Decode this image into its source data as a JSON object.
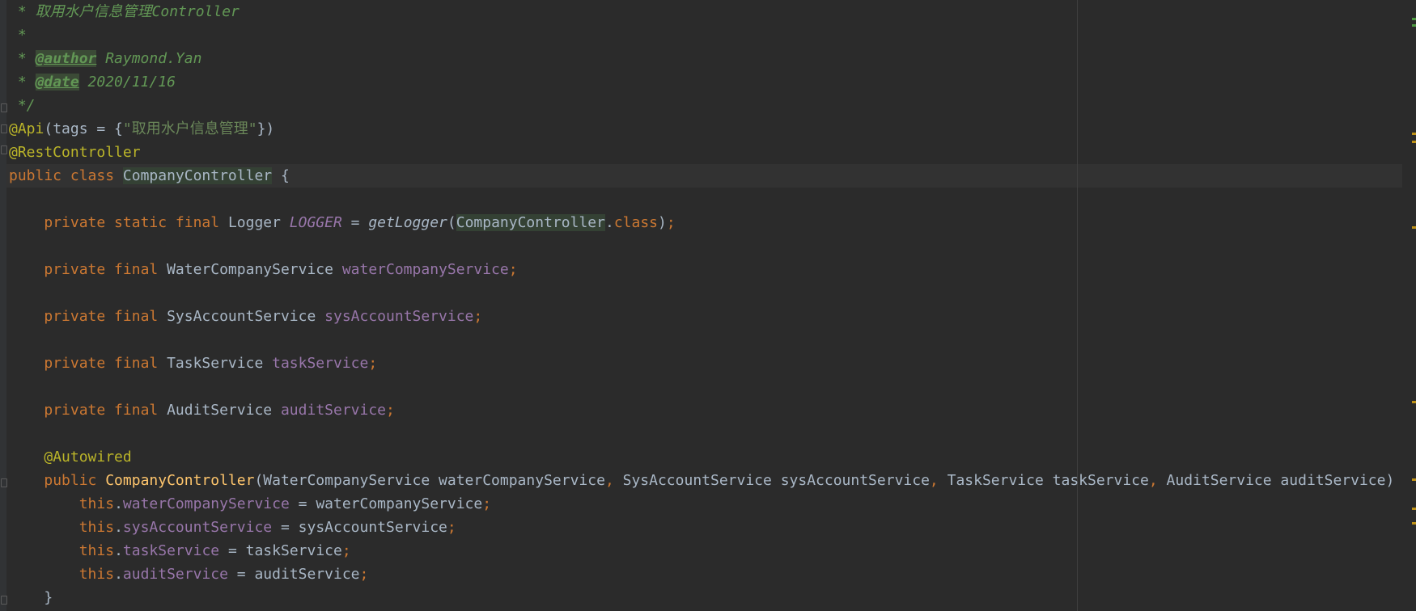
{
  "editor": {
    "lines": [
      [
        {
          "t": " * ",
          "c": "cm"
        },
        {
          "t": "取用水户信息管理Controller",
          "c": "cm"
        }
      ],
      [
        {
          "t": " *",
          "c": "cm"
        }
      ],
      [
        {
          "t": " * ",
          "c": "cm"
        },
        {
          "t": "@author",
          "c": "tag"
        },
        {
          "t": " Raymond.Yan",
          "c": "cm"
        }
      ],
      [
        {
          "t": " * ",
          "c": "cm"
        },
        {
          "t": "@date",
          "c": "tag"
        },
        {
          "t": " 2020/11/16",
          "c": "cm"
        }
      ],
      [
        {
          "t": " */",
          "c": "cm"
        }
      ],
      [
        {
          "t": "@Api",
          "c": "ann"
        },
        {
          "t": "(tags = {",
          "c": "p"
        },
        {
          "t": "\"取用水户信息管理\"",
          "c": "str"
        },
        {
          "t": "})",
          "c": "p"
        }
      ],
      [
        {
          "t": "@RestController",
          "c": "ann"
        }
      ],
      [
        {
          "t": "public class ",
          "c": "kw"
        },
        {
          "t": "CompanyController",
          "c": "hl"
        },
        {
          "t": " {",
          "c": "p"
        }
      ],
      [],
      [
        {
          "t": "    ",
          "c": "p"
        },
        {
          "t": "private static final ",
          "c": "kw"
        },
        {
          "t": "Logger ",
          "c": "p"
        },
        {
          "t": "LOGGER",
          "c": "sfld"
        },
        {
          "t": " = ",
          "c": "p"
        },
        {
          "t": "getLogger",
          "c": "smeth"
        },
        {
          "t": "(",
          "c": "p"
        },
        {
          "t": "CompanyController",
          "c": "hl"
        },
        {
          "t": ".",
          "c": "p"
        },
        {
          "t": "class",
          "c": "kw"
        },
        {
          "t": ")",
          "c": "p"
        },
        {
          "t": ";",
          "c": "kw"
        }
      ],
      [],
      [
        {
          "t": "    ",
          "c": "p"
        },
        {
          "t": "private final ",
          "c": "kw"
        },
        {
          "t": "WaterCompanyService ",
          "c": "p"
        },
        {
          "t": "waterCompanyService",
          "c": "fld"
        },
        {
          "t": ";",
          "c": "kw"
        }
      ],
      [],
      [
        {
          "t": "    ",
          "c": "p"
        },
        {
          "t": "private final ",
          "c": "kw"
        },
        {
          "t": "SysAccountService ",
          "c": "p"
        },
        {
          "t": "sysAccountService",
          "c": "fld"
        },
        {
          "t": ";",
          "c": "kw"
        }
      ],
      [],
      [
        {
          "t": "    ",
          "c": "p"
        },
        {
          "t": "private final ",
          "c": "kw"
        },
        {
          "t": "TaskService ",
          "c": "p"
        },
        {
          "t": "taskService",
          "c": "fld"
        },
        {
          "t": ";",
          "c": "kw"
        }
      ],
      [],
      [
        {
          "t": "    ",
          "c": "p"
        },
        {
          "t": "private final ",
          "c": "kw"
        },
        {
          "t": "AuditService ",
          "c": "p"
        },
        {
          "t": "auditService",
          "c": "fld"
        },
        {
          "t": ";",
          "c": "kw"
        }
      ],
      [],
      [
        {
          "t": "    ",
          "c": "p"
        },
        {
          "t": "@Autowired",
          "c": "ann"
        }
      ],
      [
        {
          "t": "    ",
          "c": "p"
        },
        {
          "t": "public ",
          "c": "kw"
        },
        {
          "t": "CompanyController",
          "c": "mdecl"
        },
        {
          "t": "(WaterCompanyService waterCompanyService",
          "c": "p"
        },
        {
          "t": ", ",
          "c": "kw"
        },
        {
          "t": "SysAccountService sysAccountService",
          "c": "p"
        },
        {
          "t": ", ",
          "c": "kw"
        },
        {
          "t": "TaskService taskService",
          "c": "p"
        },
        {
          "t": ", ",
          "c": "kw"
        },
        {
          "t": "AuditService auditService)",
          "c": "p"
        }
      ],
      [
        {
          "t": "        ",
          "c": "p"
        },
        {
          "t": "this",
          "c": "kw"
        },
        {
          "t": ".",
          "c": "p"
        },
        {
          "t": "waterCompanyService",
          "c": "fld"
        },
        {
          "t": " = waterCompanyService",
          "c": "p"
        },
        {
          "t": ";",
          "c": "kw"
        }
      ],
      [
        {
          "t": "        ",
          "c": "p"
        },
        {
          "t": "this",
          "c": "kw"
        },
        {
          "t": ".",
          "c": "p"
        },
        {
          "t": "sysAccountService",
          "c": "fld"
        },
        {
          "t": " = sysAccountService",
          "c": "p"
        },
        {
          "t": ";",
          "c": "kw"
        }
      ],
      [
        {
          "t": "        ",
          "c": "p"
        },
        {
          "t": "this",
          "c": "kw"
        },
        {
          "t": ".",
          "c": "p"
        },
        {
          "t": "taskService",
          "c": "fld"
        },
        {
          "t": " = taskService",
          "c": "p"
        },
        {
          "t": ";",
          "c": "kw"
        }
      ],
      [
        {
          "t": "        ",
          "c": "p"
        },
        {
          "t": "this",
          "c": "kw"
        },
        {
          "t": ".",
          "c": "p"
        },
        {
          "t": "auditService",
          "c": "fld"
        },
        {
          "t": " = auditService",
          "c": "p"
        },
        {
          "t": ";",
          "c": "kw"
        }
      ],
      [
        {
          "t": "    }",
          "c": "p"
        }
      ]
    ]
  },
  "colors": {
    "background": "#2b2b2b",
    "keyword": "#cc7832",
    "annotation": "#bbb529",
    "string": "#6a8759",
    "field": "#9876aa",
    "comment": "#629755",
    "method_declaration": "#ffc66d",
    "default_text": "#a9b7c6"
  }
}
